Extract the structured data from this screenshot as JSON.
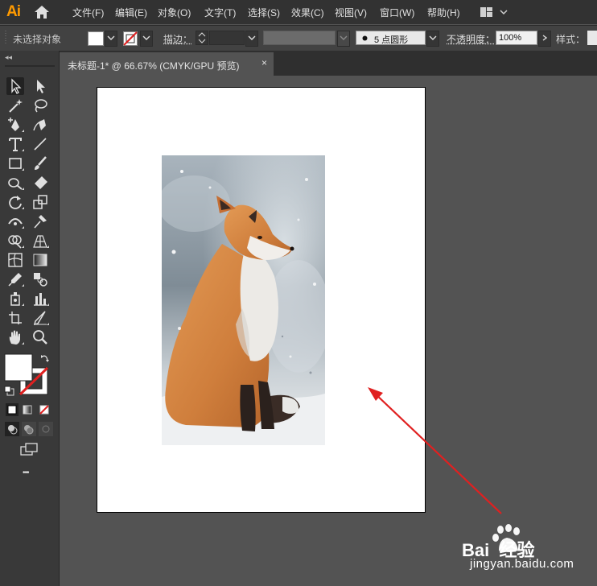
{
  "app": {
    "logo_text": "Ai"
  },
  "menu": [
    "文件(F)",
    "编辑(E)",
    "对象(O)",
    "文字(T)",
    "选择(S)",
    "效果(C)",
    "视图(V)",
    "窗口(W)",
    "帮助(H)"
  ],
  "control_bar": {
    "no_selection": "未选择对象",
    "stroke_label": "描边：",
    "brush_value": "5 点圆形",
    "opacity_label": "不透明度：",
    "opacity_value": "100%",
    "style_label": "样式："
  },
  "document_tab": {
    "title": "未标题-1* @ 66.67% (CMYK/GPU 预览)",
    "close": "×"
  },
  "tools": {
    "more": "•••"
  },
  "watermark": {
    "brand_text": "Bai  经验",
    "url": "jingyan.baidu.com"
  },
  "colors": {
    "accent_arrow": "#e02020",
    "logo": "#ff9a00"
  }
}
